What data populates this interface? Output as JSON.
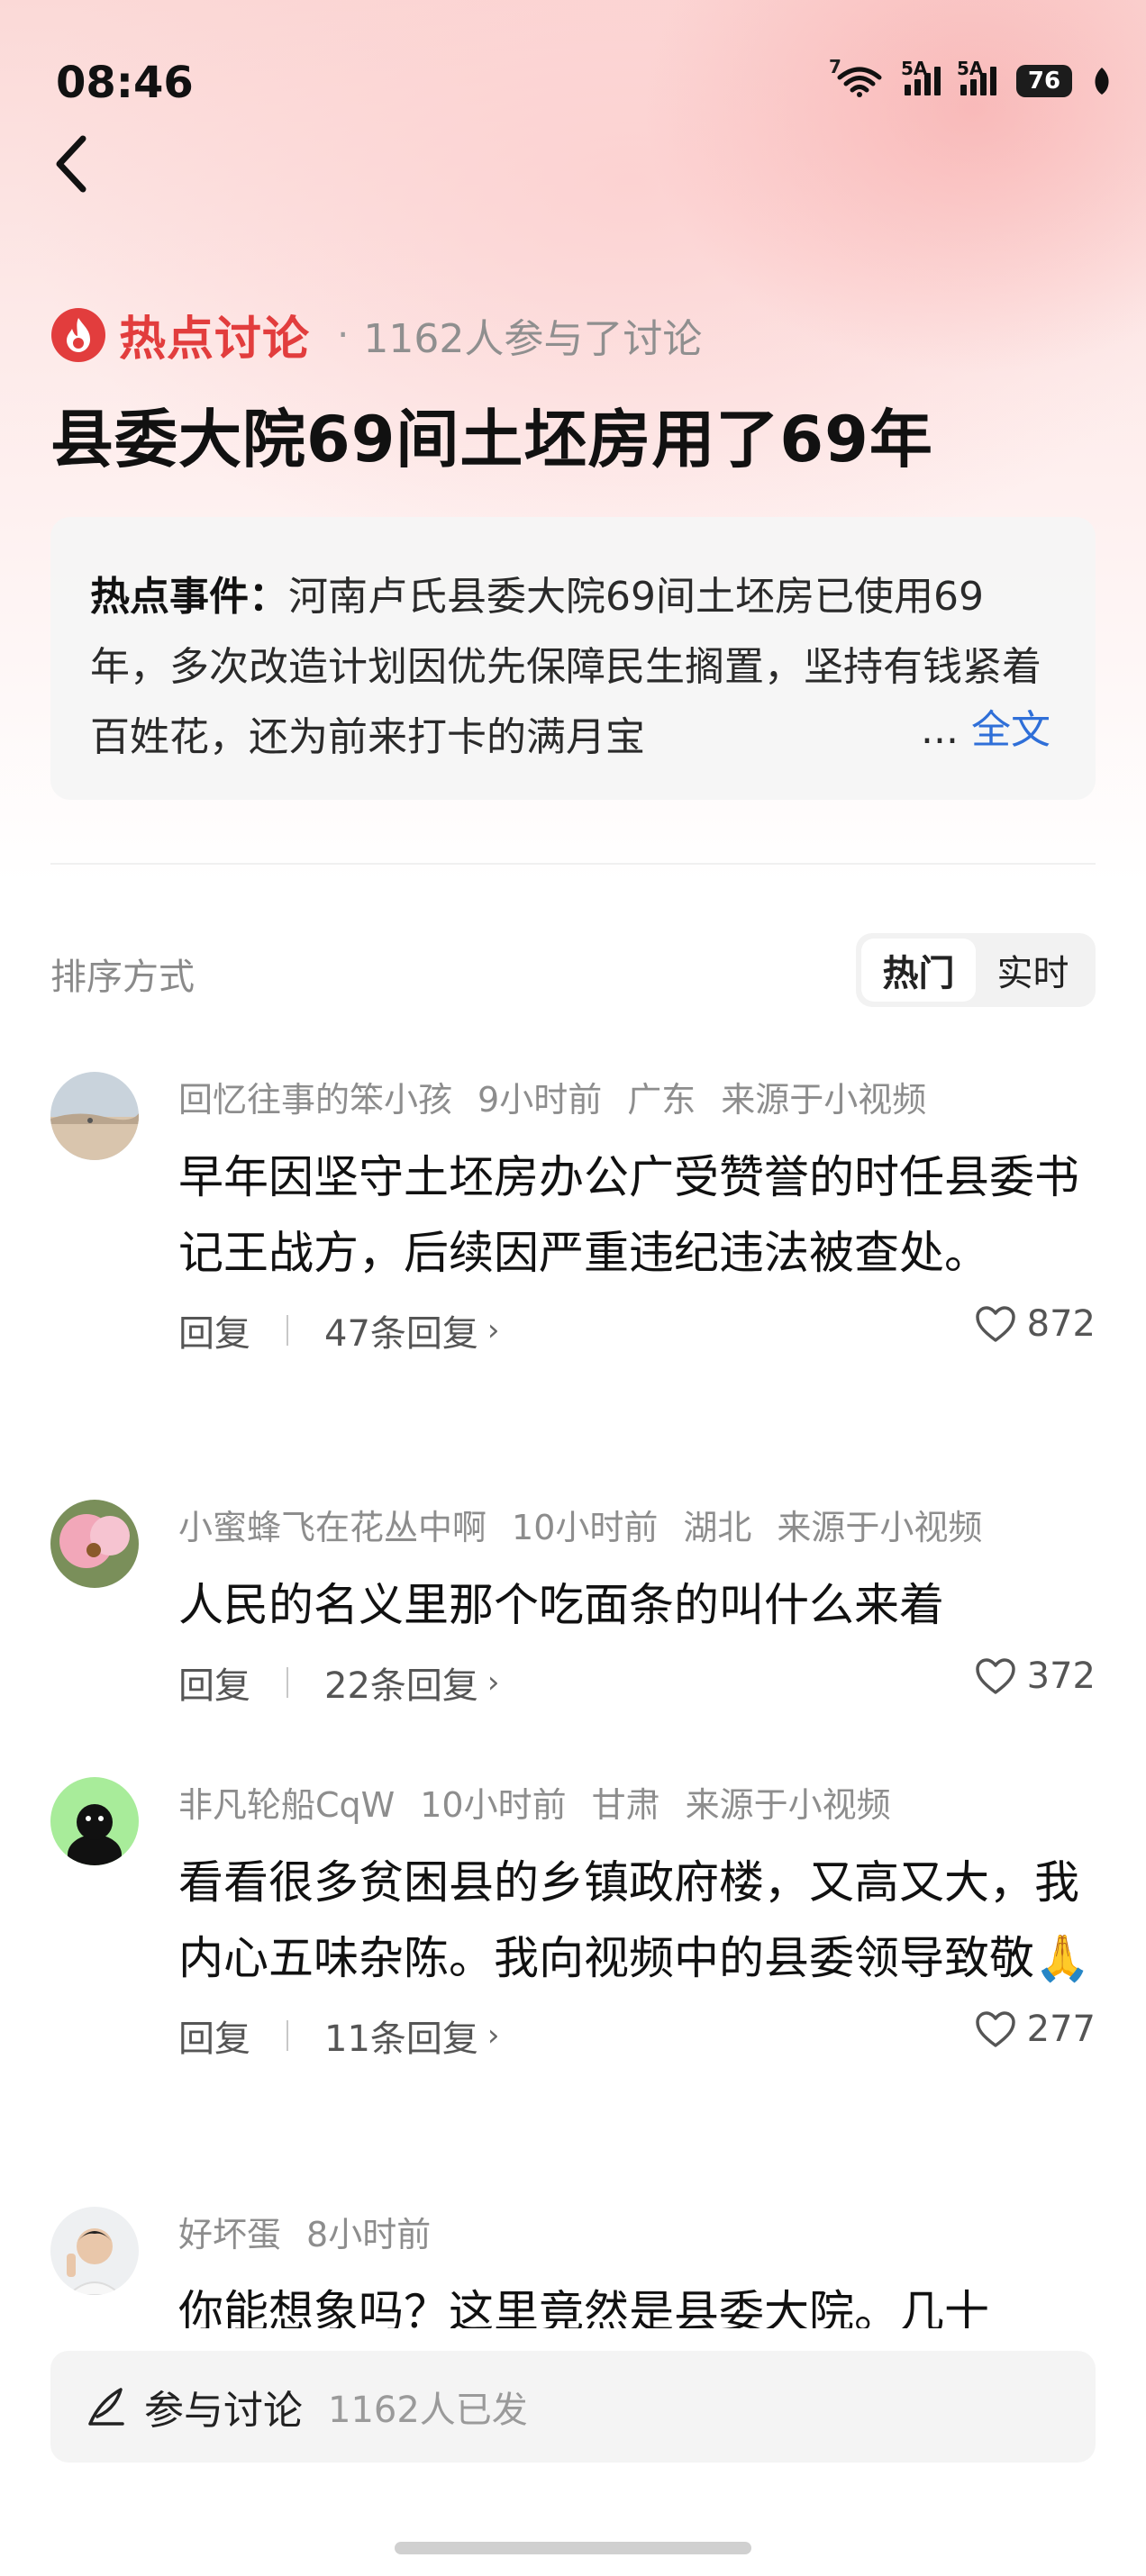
{
  "status": {
    "time": "08:46",
    "wifi_label": "7",
    "sig1_label": "5A",
    "sig2_label": "5A",
    "battery": "76"
  },
  "header": {
    "hot_label": "热点讨论",
    "participants": "1162人参与了讨论",
    "title": "县委大院69间土坯房用了69年",
    "summary_lead": "热点事件：",
    "summary_text": "河南卢氏县委大院69间土坯房已使用69年，多次改造计划因优先保障民生搁置，坚持有钱紧着百姓花，还为前来打卡的满月宝",
    "summary_ellipsis": "...",
    "summary_more": "全文"
  },
  "sort": {
    "label": "排序方式",
    "options": [
      "热门",
      "实时"
    ],
    "active": "热门"
  },
  "comments": [
    {
      "user": "回忆往事的笨小孩",
      "time": "9小时前",
      "location": "广东",
      "source": "来源于小视频",
      "text": "早年因坚守土坯房办公广受赞誉的时任县委书记王战方，后续因严重违纪违法被查处。",
      "reply": "回复",
      "replies": "47条回复",
      "likes": "872"
    },
    {
      "user": "小蜜蜂飞在花丛中啊",
      "time": "10小时前",
      "location": "湖北",
      "source": "来源于小视频",
      "text": "人民的名义里那个吃面条的叫什么来着",
      "reply": "回复",
      "replies": "22条回复",
      "likes": "372"
    },
    {
      "user": "非凡轮船CqW",
      "time": "10小时前",
      "location": "甘肃",
      "source": "来源于小视频",
      "text": "看看很多贫困县的乡镇政府楼，又高又大，我内心五味杂陈。我向视频中的县委领导致敬🙏",
      "reply": "回复",
      "replies": "11条回复",
      "likes": "277"
    },
    {
      "user": "好坏蛋",
      "time": "8小时前",
      "text": "你能想象吗？这里竟然是县委大院。几十"
    }
  ],
  "composer": {
    "label": "参与讨论",
    "count": "1162人已发"
  },
  "colors": {
    "accent": "#e23d3d",
    "link": "#2f6fd8"
  }
}
